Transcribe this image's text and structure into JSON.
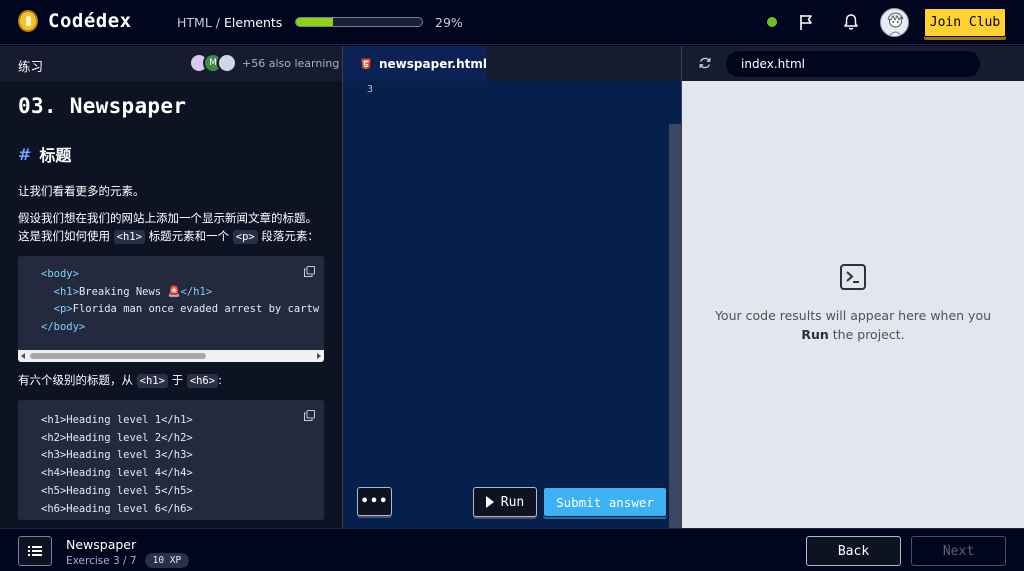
{
  "header": {
    "logo_text": "Codédex",
    "breadcrumb": {
      "course": "HTML",
      "separator": "/",
      "section": "Elements"
    },
    "progress_percent": 29,
    "progress_label": "29%",
    "join_label": "Join Club",
    "accent": "#ffd22f",
    "progress_color": "#8bd11a"
  },
  "left_panel": {
    "tab_title": "练习",
    "learners_text": "+56 also learning",
    "learner_avatar_letter": "M",
    "lesson": {
      "title": "03. Newspaper",
      "section_heading": "标题",
      "p1": "让我们看看更多的元素。",
      "p2_a": "假设我们想在我们的网站上添加一个显示新闻文章的标题。这是我们如何使用",
      "p2_code1": "<h1>",
      "p2_b": "标题元素和一个",
      "p2_code2": "<p>",
      "p2_c": "段落元素：",
      "code1": {
        "line1": "<body>",
        "line2_open": "<h1>",
        "line2_text": "Breaking News 🚨",
        "line2_close": "</h1>",
        "line3_open": "<p>",
        "line3_text": "Florida man once evaded arrest by cartw",
        "line4": "</body>"
      },
      "p3_a": "有六个级别的标题，从",
      "p3_code1": "<h1>",
      "p3_b": "于",
      "p3_code2": "<h6>",
      "p3_c": ":",
      "code2_lines": [
        "<h1>Heading level 1</h1>",
        "<h2>Heading level 2</h2>",
        "<h3>Heading level 3</h3>",
        "<h4>Heading level 4</h4>",
        "<h5>Heading level 5</h5>",
        "<h6>Heading level 6</h6>"
      ]
    }
  },
  "editor": {
    "file_tab": "newspaper.html",
    "line_number": "3",
    "more_label": "•••",
    "run_label": "Run",
    "submit_label": "Submit answer"
  },
  "preview": {
    "url": "index.html",
    "message_a": "Your code results will appear here when you ",
    "message_bold": "Run",
    "message_b": " the project."
  },
  "footer": {
    "exercise_title": "Newspaper",
    "exercise_meta": "Exercise 3 / 7",
    "xp": "10 XP",
    "back_label": "Back",
    "next_label": "Next"
  }
}
